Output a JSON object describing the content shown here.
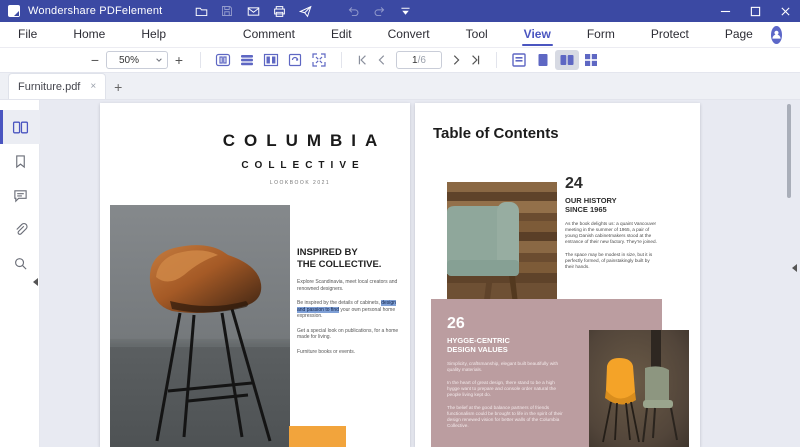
{
  "colors": {
    "titlebar": "#3b49a3",
    "accent": "#4a55c0",
    "workspace": "#e8eaf2",
    "mauve_block": "#bb9da0",
    "orange_block": "#f2a43c",
    "highlight_blue": "#7fa0d6",
    "teal_sofa": "#8fa79b",
    "orange_chair": "#f4a328",
    "leather": "#b06028"
  },
  "titlebar": {
    "app_title": "Wondershare PDFelement"
  },
  "menubar": {
    "items": [
      {
        "label": "File"
      },
      {
        "label": "Home"
      },
      {
        "label": "Help"
      },
      {
        "label": "Comment"
      },
      {
        "label": "Edit"
      },
      {
        "label": "Convert"
      },
      {
        "label": "Tool"
      },
      {
        "label": "View"
      },
      {
        "label": "Form"
      },
      {
        "label": "Protect"
      },
      {
        "label": "Page"
      }
    ]
  },
  "toolbar": {
    "zoom_value": "50%",
    "zoom_minus": "−",
    "zoom_plus": "+",
    "page_current": "1",
    "page_total": "/6"
  },
  "tabbar": {
    "active_tab": "Furniture.pdf",
    "close_glyph": "×",
    "new_tab_glyph": "+"
  },
  "document": {
    "page1": {
      "brand_title": "COLUMBIA",
      "brand_subtitle": "COLLECTIVE",
      "brand_tagline": "LOOKBOOK 2021",
      "heading_line1": "INSPIRED BY",
      "heading_line2": "THE COLLECTIVE.",
      "para1": "Explore Scandinavia, meet local creators and renowned designers.",
      "para2_pre": "Be inspired by the details of cabinets, ",
      "para2_highlight": "design and passion to find",
      "para2_post": " your own personal home expression.",
      "para3": "Get a special look on publications, for a home made for living.",
      "para4": "Furniture books or events."
    },
    "page2": {
      "title": "Table of Contents",
      "s1_number": "24",
      "s1_heading1": "OUR HISTORY",
      "s1_heading2": "SINCE 1965",
      "s1_para1": "As the book delights us: a quaint Vancouver meeting in the summer of 1965, a pair of young Danish cabinetmakers stood at the entrance of their new factory. They're joined.",
      "s1_para2": "The space may be modest in size, but it is perfectly formed, of painstakingly built by their hands.",
      "s2_number": "26",
      "s2_heading1": "HYGGE-CENTRIC",
      "s2_heading2": "DESIGN VALUES",
      "s2_para1": "Simplicity, craftsmanship, elegant built beautifully with quality materials.",
      "s2_para2": "In the heart of great design, there stand to be a high hygge want to prepare and console order natural the people living kept do.",
      "s2_para3": "The belief at the good balance partners of friends functionalism could be brought to life in the spirit of their design renewed vision for better walls of the Columbia Collective."
    }
  }
}
